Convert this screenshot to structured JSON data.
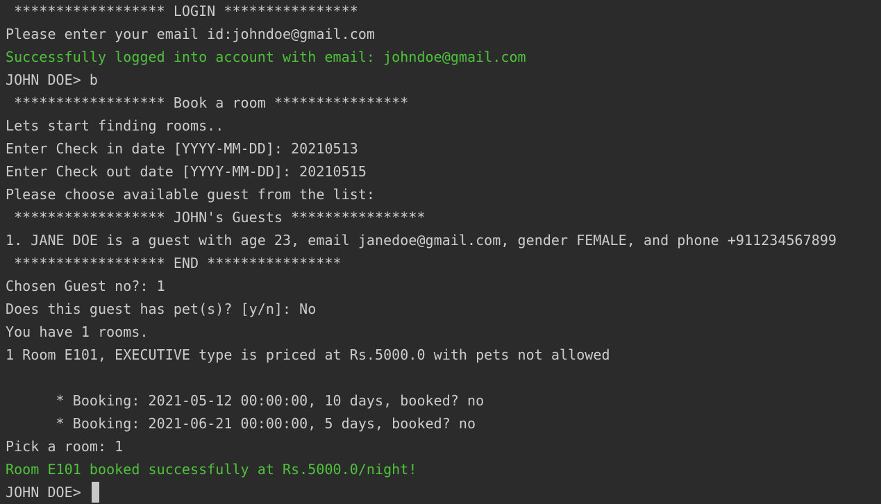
{
  "terminal": {
    "lines": [
      {
        "text": " ****************** LOGIN ****************",
        "color": "#cccccc"
      },
      {
        "text": "Please enter your email id:johndoe@gmail.com",
        "color": "#cccccc"
      },
      {
        "text": "Successfully logged into account with email: johndoe@gmail.com",
        "color": "#4ec23a"
      },
      {
        "text": "JOHN DOE> b",
        "color": "#cccccc"
      },
      {
        "text": " ****************** Book a room ****************",
        "color": "#cccccc"
      },
      {
        "text": "Lets start finding rooms..",
        "color": "#cccccc"
      },
      {
        "text": "Enter Check in date [YYYY-MM-DD]: 20210513",
        "color": "#cccccc"
      },
      {
        "text": "Enter Check out date [YYYY-MM-DD]: 20210515",
        "color": "#cccccc"
      },
      {
        "text": "Please choose available guest from the list:",
        "color": "#cccccc"
      },
      {
        "text": " ****************** JOHN's Guests ****************",
        "color": "#cccccc"
      },
      {
        "text": "1. JANE DOE is a guest with age 23, email janedoe@gmail.com, gender FEMALE, and phone +911234567899",
        "color": "#cccccc"
      },
      {
        "text": " ****************** END ****************",
        "color": "#cccccc"
      },
      {
        "text": "Chosen Guest no?: 1",
        "color": "#cccccc"
      },
      {
        "text": "Does this guest has pet(s)? [y/n]: No",
        "color": "#cccccc"
      },
      {
        "text": "You have 1 rooms.",
        "color": "#cccccc"
      },
      {
        "text": "1 Room E101, EXECUTIVE type is priced at Rs.5000.0 with pets not allowed",
        "color": "#cccccc"
      },
      {
        "text": "",
        "color": "#cccccc"
      },
      {
        "text": "      * Booking: 2021-05-12 00:00:00, 10 days, booked? no",
        "color": "#cccccc"
      },
      {
        "text": "      * Booking: 2021-06-21 00:00:00, 5 days, booked? no",
        "color": "#cccccc"
      },
      {
        "text": "Pick a room: 1",
        "color": "#cccccc"
      },
      {
        "text": "Room E101 booked successfully at Rs.5000.0/night!",
        "color": "#4ec23a"
      }
    ],
    "prompt": "JOHN DOE> ",
    "colors": {
      "background": "#2b2b2b",
      "text": "#cccccc",
      "success": "#4ec23a",
      "cursor": "#c8c8c8"
    }
  }
}
